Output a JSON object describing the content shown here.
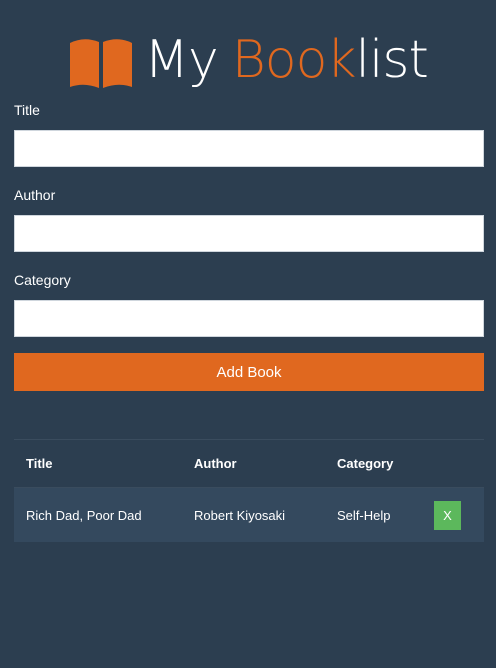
{
  "header": {
    "logo_word_my": "My",
    "logo_word_book": "Book",
    "logo_word_list": "list",
    "icon": "open-book-icon",
    "accent_color": "#e0681f",
    "background_color": "#2c3e50"
  },
  "form": {
    "title_label": "Title",
    "title_value": "",
    "author_label": "Author",
    "author_value": "",
    "category_label": "Category",
    "category_value": "",
    "submit_label": "Add Book"
  },
  "table": {
    "headers": [
      "Title",
      "Author",
      "Category"
    ],
    "rows": [
      {
        "title": "Rich Dad, Poor Dad",
        "author": "Robert Kiyosaki",
        "category": "Self-Help",
        "delete_label": "X"
      }
    ],
    "delete_button_color": "#5cb85c"
  }
}
